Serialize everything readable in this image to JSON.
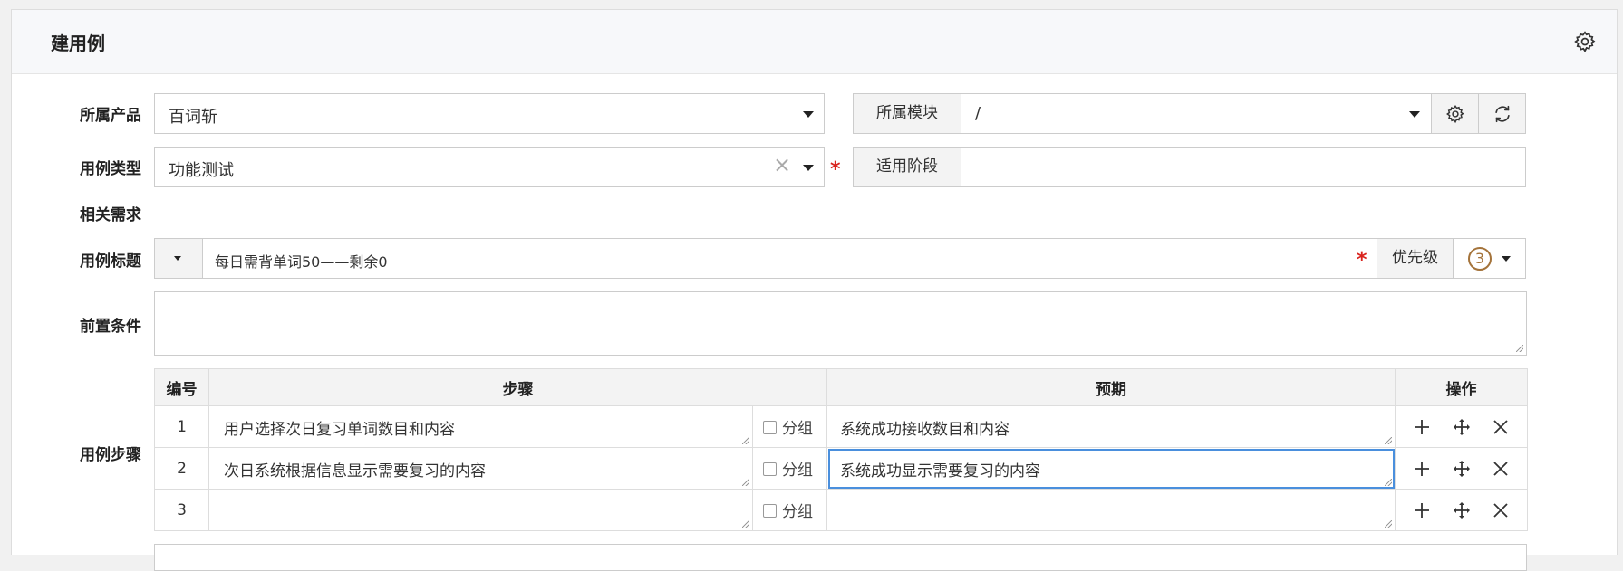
{
  "header": {
    "title": "建用例"
  },
  "form": {
    "product_label": "所属产品",
    "product_value": "百词斩",
    "module_label": "所属模块",
    "module_value": "/",
    "type_label": "用例类型",
    "type_value": "功能测试",
    "stage_label": "适用阶段",
    "stage_value": "",
    "story_label": "相关需求",
    "title_label": "用例标题",
    "title_value": "每日需背单词50——剩余0",
    "priority_label": "优先级",
    "priority_value": "3",
    "precondition_label": "前置条件",
    "precondition_value": "",
    "steps_label": "用例步骤",
    "required_mark": "*",
    "clear_mark": "×",
    "priority_color": "#a4733a"
  },
  "steps": {
    "headers": [
      "编号",
      "步骤",
      "预期",
      "操作"
    ],
    "group_label": "分组",
    "rows": [
      {
        "no": "1",
        "step": "用户选择次日复习单词数目和内容",
        "expect": "系统成功接收数目和内容"
      },
      {
        "no": "2",
        "step": "次日系统根据信息显示需要复习的内容",
        "expect": "系统成功显示需要复习的内容"
      },
      {
        "no": "3",
        "step": "",
        "expect": ""
      }
    ]
  }
}
